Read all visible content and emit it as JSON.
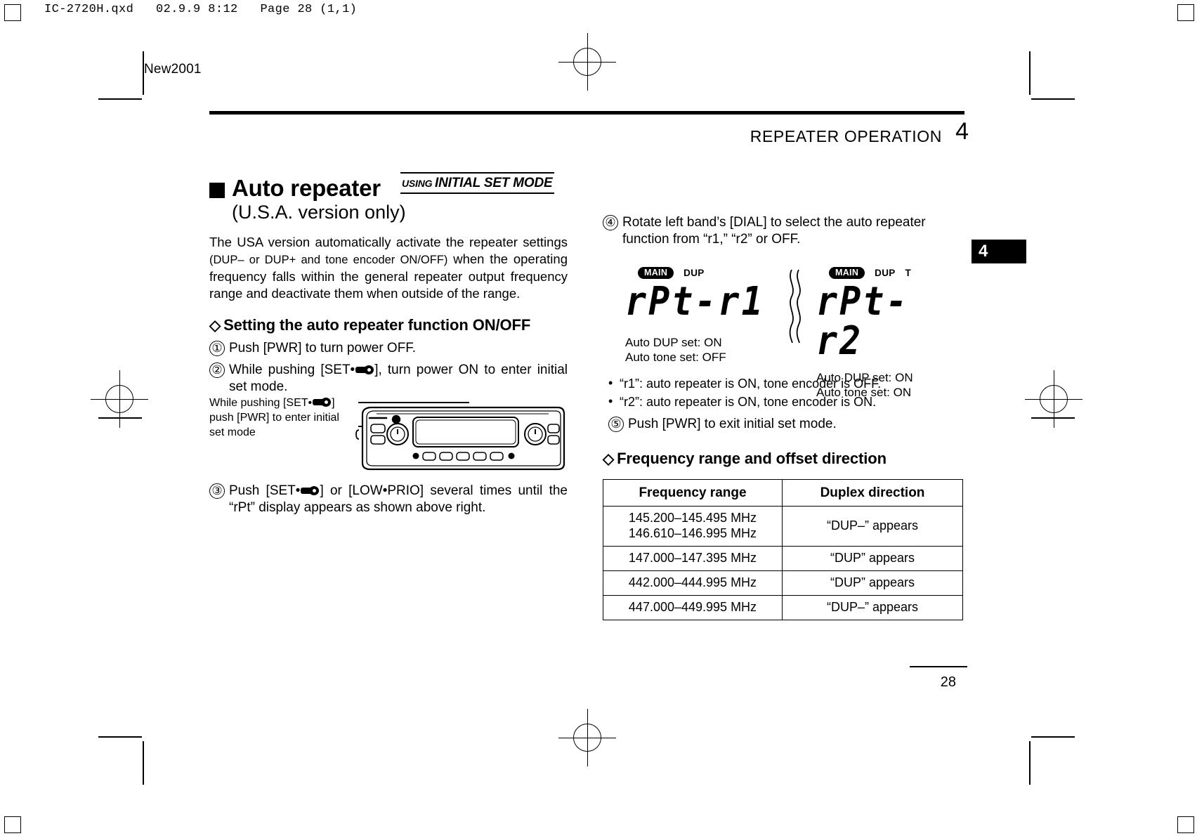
{
  "file_header": "IC-2720H.qxd   02.9.9 8:12   Page 28 (1,1)",
  "corner_mark": "New2001",
  "running_head": {
    "title": "REPEATER OPERATION",
    "chapter_number": "4",
    "tab_number": "4"
  },
  "folio": "28",
  "section": {
    "title": "Auto repeater",
    "subtitle": "(U.S.A. version only)",
    "badge_prefix": "USING ",
    "badge_text": "INITIAL SET MODE",
    "intro_part1": "The USA version automatically activate the repeater settings ",
    "intro_part2": "(DUP– or DUP+ and tone encoder ON/OFF)",
    "intro_part3": " when the operating frequency falls within the general repeater output frequency range and deactivate them when outside of the range."
  },
  "subsection_on_off": {
    "heading": "Setting the auto repeater function ON/OFF",
    "steps": [
      {
        "num": "①",
        "pre": "Push [PWR] to turn power OFF.",
        "post": ""
      },
      {
        "num": "②",
        "pre": "While pushing [SET•",
        "post": "], turn power ON to enter initial set mode."
      },
      {
        "num": "③",
        "pre": "Push [SET•",
        "post": "] or [LOW•PRIO] several times until the “rPt” display appears as shown above right."
      }
    ]
  },
  "radio_figure": {
    "callout_line1_pre": "While pushing [SET•",
    "callout_line1_post": "]",
    "callout_line2": "push [PWR] to enter initial",
    "callout_line3": "set mode"
  },
  "right_column": {
    "step4": {
      "num": "④",
      "text": "Rotate left band’s [DIAL] to select the auto repeater function from “r1,” “r2” or OFF."
    },
    "step5": {
      "num": "⑤",
      "text": "Push [PWR] to exit initial set mode."
    },
    "lcd_left": {
      "pill": "MAIN",
      "ind1": "DUP",
      "ind2": "",
      "segment": "rPt-r1",
      "caption_line1": "Auto DUP set: ON",
      "caption_line2": "Auto tone set: OFF"
    },
    "lcd_right": {
      "pill": "MAIN",
      "ind1": "DUP",
      "ind2": "T",
      "segment": "rPt-r2",
      "caption_line1": "Auto DUP set: ON",
      "caption_line2": "Auto tone set: ON"
    },
    "bullets": [
      "“r1”: auto repeater is ON, tone encoder is OFF.",
      "“r2”: auto repeater is ON, tone encoder is ON."
    ]
  },
  "freq_section": {
    "heading": "Frequency range and offset direction",
    "columns": [
      "Frequency range",
      "Duplex direction"
    ],
    "rows": [
      {
        "range": "145.200–145.495 MHz",
        "range2": "146.610–146.995 MHz",
        "direction": "“DUP–” appears"
      },
      {
        "range": "147.000–147.395 MHz",
        "range2": "",
        "direction": "“DUP” appears"
      },
      {
        "range": "442.000–444.995 MHz",
        "range2": "",
        "direction": "“DUP” appears"
      },
      {
        "range": "447.000–449.995 MHz",
        "range2": "",
        "direction": "“DUP–” appears"
      }
    ]
  }
}
